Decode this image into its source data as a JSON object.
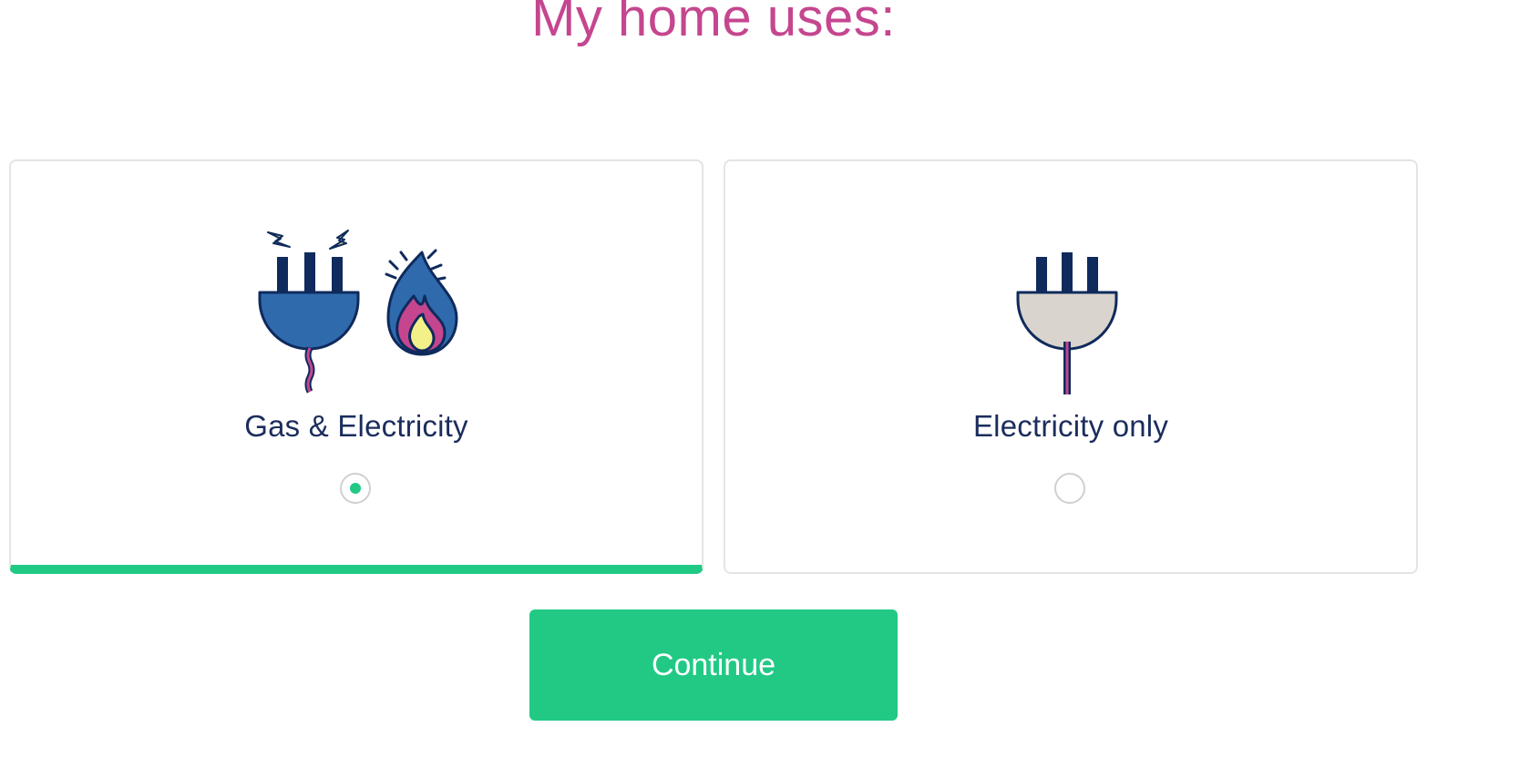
{
  "title": "My home uses:",
  "options": [
    {
      "label": "Gas & Electricity",
      "selected": true,
      "icons": [
        "electric-plug-with-sparks-icon",
        "gas-flame-icon"
      ]
    },
    {
      "label": "Electricity only",
      "selected": false,
      "icons": [
        "electric-plug-icon"
      ]
    }
  ],
  "continue_label": "Continue",
  "colors": {
    "title": "#c5468f",
    "accent": "#22c985",
    "text": "#1b2d5c",
    "plug_blue": "#2f6aad",
    "plug_grey": "#d9d4cd",
    "navy": "#0f2a5c",
    "spark_yellow": "#f3f08a"
  }
}
